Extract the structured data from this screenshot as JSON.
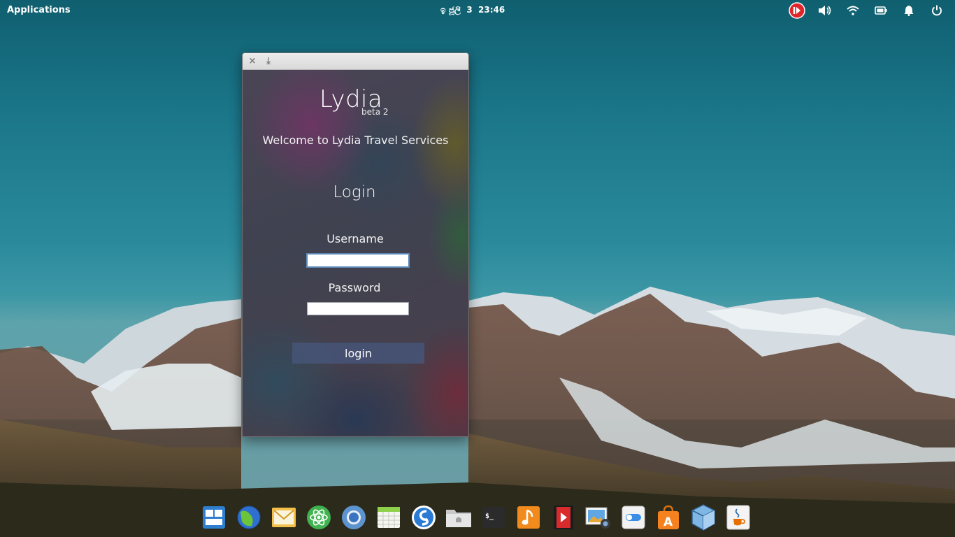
{
  "panel": {
    "applications_label": "Applications",
    "clock_text": "ඉ ජූලි  3  23:46",
    "tray_icons": [
      "screen-recorder-icon",
      "volume-icon",
      "wifi-icon",
      "battery-icon",
      "notifications-bell-icon",
      "power-icon"
    ]
  },
  "window": {
    "close_glyph": "×",
    "minimize_glyph": "⤓",
    "logo": "Lydia",
    "beta": "beta 2",
    "welcome": "Welcome to Lydia Travel Services",
    "heading": "Login",
    "username_label": "Username",
    "username_value": "",
    "password_label": "Password",
    "password_value": "",
    "login_button": "login"
  },
  "dock": {
    "apps": [
      "multitasking-view-icon",
      "web-browser-icon",
      "mail-icon",
      "atom-editor-icon",
      "chromium-icon",
      "calendar-icon",
      "simplenote-icon",
      "files-icon",
      "terminal-icon",
      "music-icon",
      "videos-icon",
      "photos-icon",
      "system-settings-icon",
      "appcenter-icon",
      "virtualbox-icon",
      "java-icon"
    ]
  },
  "colors": {
    "sky": "#1a7588",
    "window_button": "#465578",
    "recorder_red": "#e0262b"
  }
}
